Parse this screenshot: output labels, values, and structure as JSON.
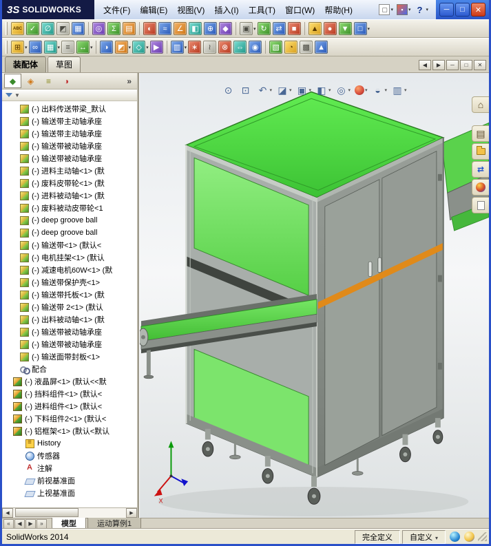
{
  "window": {
    "logo_3s": "3S",
    "logo_name": "SOLIDWORKS",
    "controls": [
      {
        "name": "minimize-button",
        "glyph": "─",
        "cls": "min"
      },
      {
        "name": "maximize-button",
        "glyph": "□",
        "cls": "max"
      },
      {
        "name": "close-button",
        "glyph": "✕",
        "cls": "close"
      }
    ]
  },
  "menubar": {
    "items": [
      {
        "label": "文件(F)"
      },
      {
        "label": "编辑(E)"
      },
      {
        "label": "视图(V)"
      },
      {
        "label": "插入(I)"
      },
      {
        "label": "工具(T)"
      },
      {
        "label": "窗口(W)"
      },
      {
        "label": "帮助(H)"
      }
    ]
  },
  "titlebar_icons": [
    {
      "name": "new-document-icon",
      "glyph": "▢",
      "cls": "ti-doc",
      "arrow": "▾"
    },
    {
      "name": "open-document-icon",
      "glyph": "▪",
      "cls": "ti-opt",
      "arrow": "▾"
    },
    {
      "name": "help-icon",
      "glyph": "?",
      "cls": "ti-help",
      "arrow": "▾"
    }
  ],
  "toolbar1": {
    "icons": [
      {
        "name": "spellcheck-icon",
        "glyph": "ABC",
        "cls": "g-yellow sm",
        "arrow": ""
      },
      {
        "name": "design-checker-icon",
        "glyph": "✓",
        "cls": "g-green",
        "arrow": ""
      },
      {
        "name": "measure-icon",
        "glyph": "∅",
        "cls": "g-teal",
        "arrow": ""
      },
      {
        "name": "mass-properties-icon",
        "glyph": "◩",
        "cls": "g-gray",
        "arrow": ""
      },
      {
        "name": "section-properties-icon",
        "glyph": "▦",
        "cls": "g-blue",
        "arrow": "",
        "wrap": "grp-end"
      },
      {
        "name": "sensor-icon",
        "glyph": "◎",
        "cls": "g-purple",
        "arrow": ""
      },
      {
        "name": "equations-icon",
        "glyph": "Σ",
        "cls": "g-green",
        "arrow": ""
      },
      {
        "name": "statistics-icon",
        "glyph": "▤",
        "cls": "g-orange",
        "arrow": "",
        "wrap": "grp-end"
      },
      {
        "name": "draft-analysis-icon",
        "glyph": "◐",
        "cls": "g-red",
        "arrow": ""
      },
      {
        "name": "zebra-stripes-icon",
        "glyph": "≈",
        "cls": "g-blue",
        "arrow": ""
      },
      {
        "name": "draft-angle-icon",
        "glyph": "∠",
        "cls": "g-orange",
        "arrow": ""
      },
      {
        "name": "thickness-analysis-icon",
        "glyph": "◧",
        "cls": "g-teal",
        "arrow": ""
      },
      {
        "name": "symmetry-check-icon",
        "glyph": "⊕",
        "cls": "g-blue",
        "arrow": ""
      },
      {
        "name": "compare-documents-icon",
        "glyph": "◆",
        "cls": "g-purple",
        "arrow": "",
        "wrap": "grp-end"
      },
      {
        "name": "options-icon",
        "glyph": "▣",
        "cls": "g-gray",
        "arrow": "▾"
      },
      {
        "name": "rebuild-icon",
        "glyph": "↻",
        "cls": "g-green",
        "arrow": ""
      },
      {
        "name": "reload-icon",
        "glyph": "⇄",
        "cls": "g-blue",
        "arrow": ""
      },
      {
        "name": "task-scheduler-icon",
        "glyph": "■",
        "cls": "g-red",
        "arrow": "",
        "wrap": "grp-end"
      },
      {
        "name": "toolbox-icon",
        "glyph": "▲",
        "cls": "g-yellow",
        "arrow": ""
      },
      {
        "name": "photoview-icon",
        "glyph": "●",
        "cls": "g-red",
        "arrow": ""
      },
      {
        "name": "sustainability-icon",
        "glyph": "▼",
        "cls": "g-green",
        "arrow": ""
      },
      {
        "name": "macro-icon",
        "glyph": "□",
        "cls": "g-blue",
        "arrow": "▾"
      }
    ]
  },
  "toolbar2": {
    "icons": [
      {
        "name": "insert-component-icon",
        "glyph": "⊞",
        "cls": "g-yellow",
        "arrow": "▾"
      },
      {
        "name": "mate-icon",
        "glyph": "∞",
        "cls": "g-blue",
        "arrow": ""
      },
      {
        "name": "linear-pattern-icon",
        "glyph": "▦",
        "cls": "g-teal",
        "arrow": "▾"
      },
      {
        "name": "smart-fasteners-icon",
        "glyph": "≡",
        "cls": "g-gray",
        "arrow": ""
      },
      {
        "name": "move-component-icon",
        "glyph": "↔",
        "cls": "g-green",
        "arrow": "▾",
        "wrap": "grp-end"
      },
      {
        "name": "show-hidden-components-icon",
        "glyph": "◑",
        "cls": "g-blue",
        "arrow": ""
      },
      {
        "name": "assembly-features-icon",
        "glyph": "◩",
        "cls": "g-orange",
        "arrow": "▾"
      },
      {
        "name": "reference-geometry-icon",
        "glyph": "◇",
        "cls": "g-teal",
        "arrow": "▾"
      },
      {
        "name": "new-motion-study-icon",
        "glyph": "▶",
        "cls": "g-purple",
        "arrow": "",
        "wrap": "grp-end"
      },
      {
        "name": "bill-of-materials-icon",
        "glyph": "▥",
        "cls": "g-blue",
        "arrow": "▾"
      },
      {
        "name": "exploded-view-icon",
        "glyph": "∗",
        "cls": "g-red",
        "arrow": ""
      },
      {
        "name": "explode-line-sketch-icon",
        "glyph": "≀",
        "cls": "g-gray",
        "arrow": ""
      },
      {
        "name": "interference-detection-icon",
        "glyph": "⊗",
        "cls": "g-red",
        "arrow": ""
      },
      {
        "name": "clearance-verification-icon",
        "glyph": "⇔",
        "cls": "g-teal",
        "arrow": ""
      },
      {
        "name": "hole-alignment-icon",
        "glyph": "◉",
        "cls": "g-blue",
        "arrow": "",
        "wrap": "grp-end"
      },
      {
        "name": "assembly-visualization-icon",
        "glyph": "▧",
        "cls": "g-green",
        "arrow": ""
      },
      {
        "name": "performance-evaluation-icon",
        "glyph": "◔",
        "cls": "g-yellow",
        "arrow": ""
      },
      {
        "name": "large-assembly-mode-icon",
        "glyph": "▩",
        "cls": "g-gray",
        "arrow": ""
      },
      {
        "name": "instant3d-icon",
        "glyph": "▲",
        "cls": "g-blue",
        "arrow": ""
      }
    ]
  },
  "commandbar": {
    "tabs": [
      {
        "name": "tab-assembly",
        "label": "装配体",
        "cls": "active"
      },
      {
        "name": "tab-sketch",
        "label": "草图",
        "cls": ""
      }
    ],
    "doc_controls": [
      {
        "name": "previous-document-button",
        "glyph": "◀"
      },
      {
        "name": "next-document-button",
        "glyph": "▶"
      },
      {
        "name": "doc-minimize-button",
        "glyph": "─"
      },
      {
        "name": "doc-restore-button",
        "glyph": "□"
      },
      {
        "name": "doc-close-button",
        "glyph": "✕"
      }
    ]
  },
  "feature_panel": {
    "manager_tabs": [
      {
        "name": "featuremanager-tab",
        "glyph": "◆",
        "gcls": "c-green",
        "cls": "active"
      },
      {
        "name": "propertymanager-tab",
        "glyph": "◈",
        "gcls": "c-orange",
        "cls": ""
      },
      {
        "name": "configurationmanager-tab",
        "glyph": "≡",
        "gcls": "c-olive",
        "cls": ""
      },
      {
        "name": "displaymanager-tab",
        "glyph": "◑",
        "gcls": "c-red",
        "cls": ""
      }
    ],
    "expand_label": "»",
    "filter_arrow": "▼",
    "tree": {
      "items": [
        {
          "label": "(-) 出料传送带梁_默认",
          "icon": "part",
          "icon_name": "part-icon",
          "ind": "i3"
        },
        {
          "label": "(-) 输送带主动轴承座",
          "icon": "part",
          "icon_name": "part-icon",
          "ind": "i3"
        },
        {
          "label": "(-) 输送带主动轴承座",
          "icon": "part",
          "icon_name": "part-icon",
          "ind": "i3"
        },
        {
          "label": "(-) 输送带被动轴承座",
          "icon": "part",
          "icon_name": "part-icon",
          "ind": "i3"
        },
        {
          "label": "(-) 输送带被动轴承座",
          "icon": "part",
          "icon_name": "part-icon",
          "ind": "i3"
        },
        {
          "label": "(-) 进料主动轴<1> (默",
          "icon": "part",
          "icon_name": "part-icon",
          "ind": "i3"
        },
        {
          "label": "(-) 废料皮带轮<1> (默",
          "icon": "part",
          "icon_name": "part-icon",
          "ind": "i3"
        },
        {
          "label": "(-) 进料被动轴<1> (默",
          "icon": "part",
          "icon_name": "part-icon",
          "ind": "i3"
        },
        {
          "label": "(-) 废料被动皮带轮<1",
          "icon": "part",
          "icon_name": "part-icon",
          "ind": "i3"
        },
        {
          "label": "(-) deep groove ball",
          "icon": "part",
          "icon_name": "part-icon",
          "ind": "i3"
        },
        {
          "label": "(-) deep groove ball",
          "icon": "part",
          "icon_name": "part-icon",
          "ind": "i3"
        },
        {
          "label": "(-) 输送带<1> (默认<",
          "icon": "part",
          "icon_name": "part-icon",
          "ind": "i3"
        },
        {
          "label": "(-) 电机挂架<1> (默认",
          "icon": "part",
          "icon_name": "part-icon",
          "ind": "i3"
        },
        {
          "label": "(-) 减速电机60W<1> (默",
          "icon": "part",
          "icon_name": "part-icon",
          "ind": "i3"
        },
        {
          "label": "(-) 输送带保护壳<1>",
          "icon": "part",
          "icon_name": "part-icon",
          "ind": "i3"
        },
        {
          "label": "(-) 输送带托板<1> (默",
          "icon": "part",
          "icon_name": "part-icon",
          "ind": "i3"
        },
        {
          "label": "(-) 输送带 2<1> (默认",
          "icon": "part",
          "icon_name": "part-icon",
          "ind": "i3"
        },
        {
          "label": "(-) 出料被动轴<1> (默",
          "icon": "part",
          "icon_name": "part-icon",
          "ind": "i3"
        },
        {
          "label": "(-) 输送带被动轴承座",
          "icon": "part",
          "icon_name": "part-icon",
          "ind": "i3"
        },
        {
          "label": "(-) 输送带被动轴承座",
          "icon": "part",
          "icon_name": "part-icon",
          "ind": "i3"
        },
        {
          "label": "(-) 输送面带封板<1>",
          "icon": "part",
          "icon_name": "part-icon",
          "ind": "i3"
        },
        {
          "label": "配合",
          "icon": "mate",
          "icon_name": "mates-folder-icon",
          "ind": "i3"
        },
        {
          "label": "(-) 液晶屏<1> (默认<<默",
          "icon": "assembly",
          "icon_name": "assembly-icon",
          "ind": "i2"
        },
        {
          "label": "(-) 挡料组件<1> (默认<",
          "icon": "assembly",
          "icon_name": "assembly-icon",
          "ind": "i2"
        },
        {
          "label": "(-) 进料组件<1> (默认<",
          "icon": "assembly",
          "icon_name": "assembly-icon",
          "ind": "i2"
        },
        {
          "label": "(-) 下料组件2<1> (默认<",
          "icon": "assembly",
          "icon_name": "assembly-icon",
          "ind": "i2"
        },
        {
          "label": "(-) 铝框架<1> (默认<默认",
          "icon": "assembly",
          "icon_name": "assembly-icon",
          "ind": "i2"
        },
        {
          "label": "History",
          "icon": "history",
          "icon_name": "history-icon",
          "ind": "i4"
        },
        {
          "label": "传感器",
          "icon": "sensor",
          "icon_name": "sensors-icon",
          "ind": "i4"
        },
        {
          "label": "注解",
          "icon": "annotation",
          "icon_name": "annotations-icon",
          "ind": "i4"
        },
        {
          "label": "前视基准面",
          "icon": "plane",
          "icon_name": "plane-icon",
          "ind": "i4"
        },
        {
          "label": "上视基准面",
          "icon": "plane",
          "icon_name": "plane-icon",
          "ind": "i4"
        }
      ]
    }
  },
  "viewport": {
    "hud": [
      {
        "name": "zoom-fit-icon",
        "glyph": "⊙",
        "cls": "",
        "arrow": ""
      },
      {
        "name": "zoom-area-icon",
        "glyph": "⊡",
        "cls": "",
        "arrow": ""
      },
      {
        "name": "previous-view-icon",
        "glyph": "↶",
        "cls": "",
        "arrow": "▾"
      },
      {
        "name": "section-view-icon",
        "glyph": "◪",
        "cls": "",
        "arrow": "▾"
      },
      {
        "name": "view-orientation-icon",
        "glyph": "▣",
        "cls": "",
        "arrow": "▾"
      },
      {
        "name": "display-style-icon",
        "glyph": "◧",
        "cls": "",
        "arrow": "▾"
      },
      {
        "name": "hide-show-items-icon",
        "glyph": "◎",
        "cls": "",
        "arrow": "▾"
      },
      {
        "name": "edit-appearance-icon",
        "glyph": "●",
        "cls": "hud-ball",
        "arrow": "▾"
      },
      {
        "name": "apply-scene-icon",
        "glyph": "◒",
        "cls": "",
        "arrow": "▾"
      },
      {
        "name": "view-settings-icon",
        "glyph": "▥",
        "cls": "",
        "arrow": "▾"
      }
    ],
    "taskpane": [
      {
        "name": "home-icon",
        "glyph": "⌂",
        "cls": "tp-home"
      },
      {
        "name": "design-library-icon",
        "glyph": "▤",
        "cls": "tp-lib"
      },
      {
        "name": "file-explorer-icon",
        "glyph": "",
        "cls": "tp-folder"
      },
      {
        "name": "view-palette-icon",
        "glyph": "⇄",
        "cls": "tp-arrows"
      },
      {
        "name": "appearances-icon",
        "glyph": "",
        "cls": "tp-sphere"
      },
      {
        "name": "custom-properties-icon",
        "glyph": "",
        "cls": "tp-paper"
      }
    ],
    "triad": {
      "x_label": "X"
    },
    "model_colors": {
      "panel_green": "#5ee04e",
      "frame_gray": "#8a908a",
      "stripe_orange": "#e08a1a"
    }
  },
  "bottom_bar": {
    "nav": [
      {
        "name": "scroll-first-button",
        "glyph": "«"
      },
      {
        "name": "scroll-prev-button",
        "glyph": "◀"
      },
      {
        "name": "scroll-next-button",
        "glyph": "▶"
      },
      {
        "name": "scroll-last-button",
        "glyph": "»"
      }
    ],
    "tabs": [
      {
        "name": "tab-model",
        "label": "模型",
        "cls": "active"
      },
      {
        "name": "tab-motion-study",
        "label": "运动算例1",
        "cls": ""
      }
    ]
  },
  "statusbar": {
    "app_name": "SolidWorks 2014",
    "definition_status": "完全定义",
    "custom_label": "自定义",
    "custom_arrow": "▾",
    "icons": [
      {
        "name": "help-sphere-icon",
        "cls": "sb-globe"
      },
      {
        "name": "community-icon",
        "cls": "sb-balloon"
      }
    ]
  }
}
